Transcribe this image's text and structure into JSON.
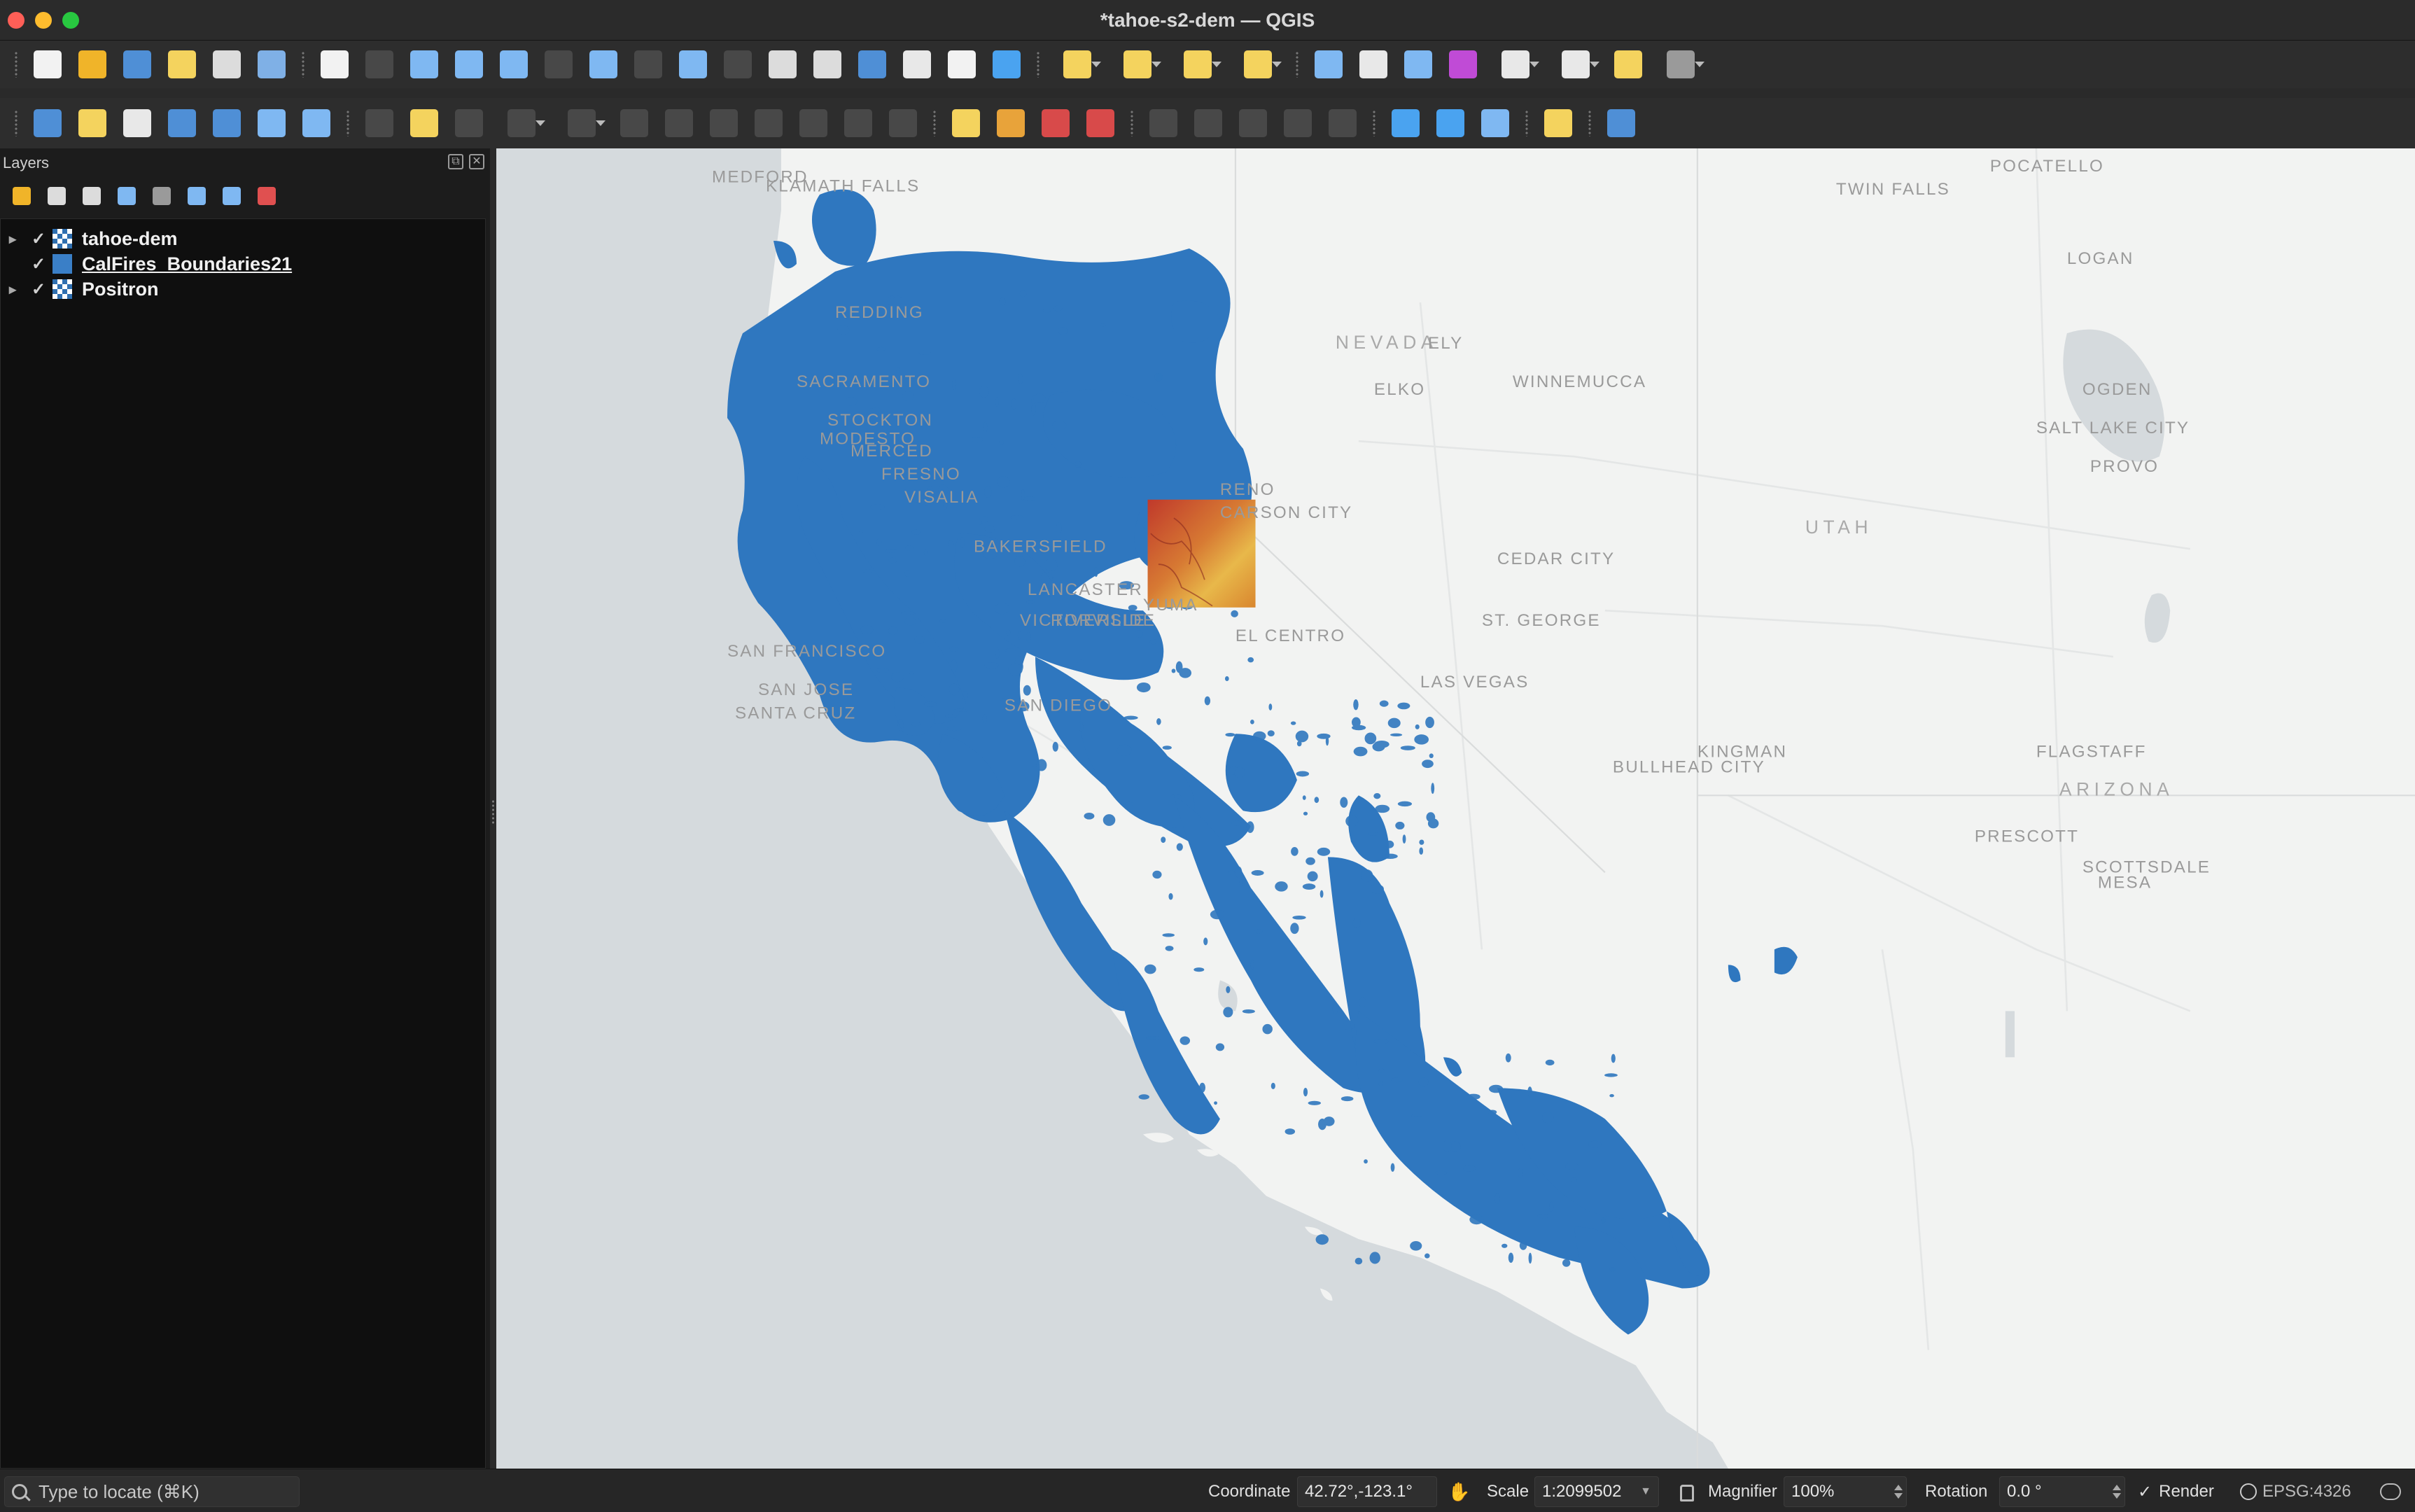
{
  "window": {
    "title": "*tahoe-s2-dem — QGIS"
  },
  "toolbar_row1": [
    {
      "name": "new-project-icon",
      "color": "#f2f2f2"
    },
    {
      "name": "open-project-icon",
      "color": "#f0b429"
    },
    {
      "name": "save-project-icon",
      "color": "#4f8fd6"
    },
    {
      "name": "new-print-layout-icon",
      "color": "#f4d35e"
    },
    {
      "name": "layout-manager-icon",
      "color": "#dcdcdc"
    },
    {
      "name": "style-manager-icon",
      "color": "#7fb0e6"
    },
    {
      "name": "pan-map-icon",
      "color": "#f2f2f2"
    },
    {
      "name": "pan-to-selection-icon",
      "color": "#6a6a6a"
    },
    {
      "name": "zoom-in-icon",
      "color": "#7fb8f2"
    },
    {
      "name": "zoom-out-icon",
      "color": "#7fb8f2"
    },
    {
      "name": "zoom-full-icon",
      "color": "#7fb8f2"
    },
    {
      "name": "zoom-to-selection-icon",
      "color": "#6a6a6a"
    },
    {
      "name": "zoom-to-layer-icon",
      "color": "#7fb8f2"
    },
    {
      "name": "zoom-native-icon",
      "color": "#6a6a6a"
    },
    {
      "name": "zoom-last-icon",
      "color": "#7fb8f2"
    },
    {
      "name": "zoom-next-icon",
      "color": "#6a6a6a"
    },
    {
      "name": "new-map-view-icon",
      "color": "#dcdcdc"
    },
    {
      "name": "new-3d-map-view-icon",
      "color": "#dcdcdc"
    },
    {
      "name": "new-bookmark-icon",
      "color": "#4f8fd6"
    },
    {
      "name": "show-bookmarks-icon",
      "color": "#e8e8e8"
    },
    {
      "name": "temporal-controller-icon",
      "color": "#f2f2f2"
    },
    {
      "name": "refresh-icon",
      "color": "#4aa3f0"
    },
    {
      "name": "select-features-icon",
      "color": "#f4d35e",
      "dropdown": true
    },
    {
      "name": "select-by-value-icon",
      "color": "#f4d35e",
      "dropdown": true
    },
    {
      "name": "deselect-features-icon",
      "color": "#f4d35e",
      "dropdown": true
    },
    {
      "name": "select-by-location-icon",
      "color": "#f4d35e",
      "dropdown": true
    },
    {
      "name": "identify-features-icon",
      "color": "#7fb8f2"
    },
    {
      "name": "open-attribute-table-icon",
      "color": "#e8e8e8"
    },
    {
      "name": "toolbox-icon",
      "color": "#7fb8f2"
    },
    {
      "name": "statistical-summary-icon",
      "color": "#c04bd6"
    },
    {
      "name": "field-calculator-icon",
      "color": "#e8e8e8",
      "dropdown": true
    },
    {
      "name": "measure-line-icon",
      "color": "#e8e8e8",
      "dropdown": true
    },
    {
      "name": "map-tips-icon",
      "color": "#f4d35e"
    },
    {
      "name": "settings-icon",
      "color": "#9a9a9a",
      "dropdown": true
    }
  ],
  "toolbar_row2": [
    {
      "name": "data-source-manager-icon",
      "color": "#4f8fd6"
    },
    {
      "name": "new-geopackage-layer-icon",
      "color": "#f4d35e"
    },
    {
      "name": "new-temporary-layer-icon",
      "color": "#e8e8e8"
    },
    {
      "name": "digitize-icon",
      "color": "#4f8fd6"
    },
    {
      "name": "add-layer-icon",
      "color": "#4f8fd6"
    },
    {
      "name": "add-raster-icon",
      "color": "#7fb8f2"
    },
    {
      "name": "add-vector-icon",
      "color": "#7fb8f2"
    },
    {
      "name": "current-edits-icon",
      "color": "#6a6a6a"
    },
    {
      "name": "toggle-editing-icon",
      "color": "#f4d35e"
    },
    {
      "name": "save-edits-icon",
      "color": "#6a6a6a"
    },
    {
      "name": "add-feature-icon",
      "color": "#6a6a6a",
      "dropdown": true
    },
    {
      "name": "vertex-tool-icon",
      "color": "#6a6a6a",
      "dropdown": true
    },
    {
      "name": "modify-attributes-icon",
      "color": "#6a6a6a"
    },
    {
      "name": "delete-selected-icon",
      "color": "#6a6a6a"
    },
    {
      "name": "cut-features-icon",
      "color": "#6a6a6a"
    },
    {
      "name": "copy-features-icon",
      "color": "#6a6a6a"
    },
    {
      "name": "paste-features-icon",
      "color": "#6a6a6a"
    },
    {
      "name": "undo-icon",
      "color": "#6a6a6a"
    },
    {
      "name": "redo-icon",
      "color": "#6a6a6a"
    },
    {
      "name": "label-tool-icon",
      "color": "#f4d35e"
    },
    {
      "name": "diagram-tool-icon",
      "color": "#e8a33a"
    },
    {
      "name": "highlight-labels-icon",
      "color": "#d84a4a"
    },
    {
      "name": "toggle-labels-icon",
      "color": "#d84a4a"
    },
    {
      "name": "move-label-icon",
      "color": "#6a6a6a"
    },
    {
      "name": "rotate-label-icon",
      "color": "#6a6a6a"
    },
    {
      "name": "change-label-icon",
      "color": "#6a6a6a"
    },
    {
      "name": "pin-label-icon",
      "color": "#6a6a6a"
    },
    {
      "name": "show-hide-labels-icon",
      "color": "#6a6a6a"
    },
    {
      "name": "wms-layer-icon",
      "color": "#4aa3f0"
    },
    {
      "name": "wfs-layer-icon",
      "color": "#4aa3f0"
    },
    {
      "name": "metasearch-icon",
      "color": "#7fb8f2"
    },
    {
      "name": "python-console-icon",
      "color": "#f4d35e"
    },
    {
      "name": "help-icon",
      "color": "#4f8fd6"
    }
  ],
  "layers_panel": {
    "title": "Layers",
    "tools": [
      "open-layer-styling-icon",
      "add-group-icon",
      "manage-visibility-icon",
      "filter-legend-icon",
      "filter-by-expression-icon",
      "expand-all-icon",
      "collapse-all-icon",
      "remove-layer-icon"
    ],
    "layers": [
      {
        "name": "tahoe-dem",
        "checked": true,
        "kind": "raster",
        "expandable": true
      },
      {
        "name": "CalFires_Boundaries21",
        "checked": true,
        "kind": "vector",
        "expandable": false
      },
      {
        "name": "Positron",
        "checked": true,
        "kind": "raster",
        "expandable": true
      }
    ]
  },
  "map": {
    "basemap_labels": [
      "MEDFORD",
      "KLAMATH FALLS",
      "REDDING",
      "SACRAMENTO",
      "STOCKTON",
      "MODESTO",
      "MERCED",
      "FRESNO",
      "VISALIA",
      "BAKERSFIELD",
      "LANCASTER",
      "VICTORVILLE",
      "NEVADA",
      "RENO",
      "CARSON CITY",
      "ELKO",
      "ELY",
      "LAS VEGAS",
      "ST. GEORGE",
      "CEDAR CITY",
      "UTAH",
      "ARIZONA",
      "KINGMAN",
      "BULLHEAD CITY",
      "FLAGSTAFF",
      "PRESCOTT",
      "SCOTTSDALE",
      "MESA",
      "OGDEN",
      "SALT LAKE CITY",
      "PROVO",
      "LOGAN",
      "POCATELLO",
      "TWIN FALLS",
      "WINNEMUCCA",
      "SAN FRANCISCO",
      "SAN JOSE",
      "SANTA CRUZ",
      "SAN DIEGO",
      "EL CENTRO",
      "YUMA",
      "RIVERSIDE"
    ],
    "fire_color": "#2f77bf",
    "dem_colors": [
      "#c0392b",
      "#e8b84a"
    ]
  },
  "statusbar": {
    "locator_placeholder": "Type to locate (⌘K)",
    "coordinate_label": "Coordinate",
    "coordinate_value": "42.72°,-123.1°",
    "scale_label": "Scale",
    "scale_value": "1:2099502",
    "magnifier_label": "Magnifier",
    "magnifier_value": "100%",
    "rotation_label": "Rotation",
    "rotation_value": "0.0 °",
    "render_label": "Render",
    "render_checked": true,
    "crs_value": "EPSG:4326"
  }
}
